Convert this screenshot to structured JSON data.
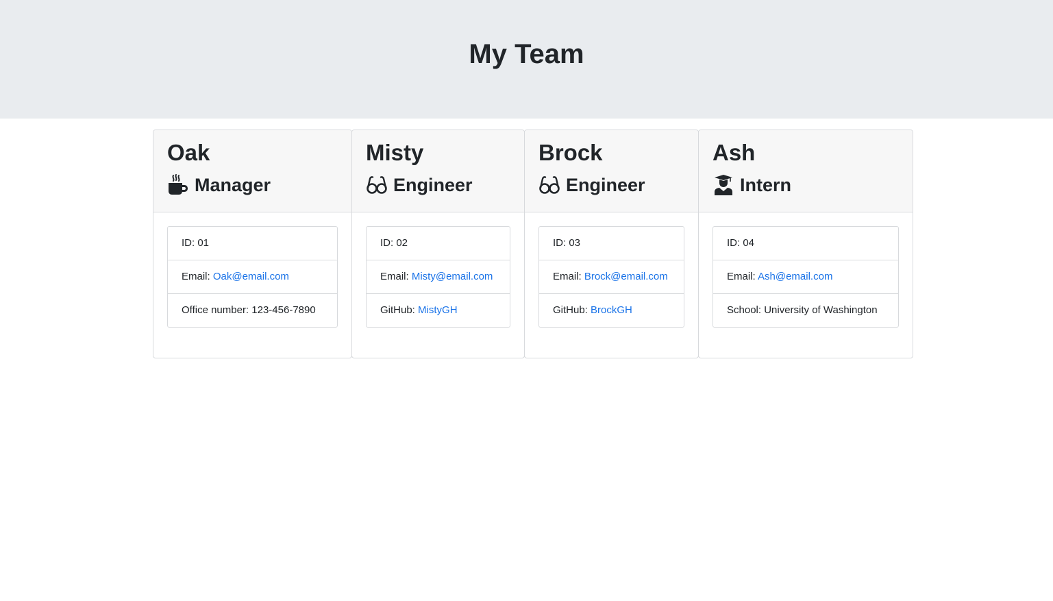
{
  "header": {
    "title": "My Team"
  },
  "members": [
    {
      "name": "Oak",
      "role": "Manager",
      "icon": "coffee-mug-icon",
      "id_label": "ID: 01",
      "email_prefix": "Email: ",
      "email": "Oak@email.com",
      "extra_prefix": "Office number: ",
      "extra_value": "123-456-7890"
    },
    {
      "name": "Misty",
      "role": "Engineer",
      "icon": "glasses-icon",
      "id_label": "ID: 02",
      "email_prefix": "Email: ",
      "email": "Misty@email.com",
      "extra_prefix": "GitHub: ",
      "extra_value": "MistyGH"
    },
    {
      "name": "Brock",
      "role": "Engineer",
      "icon": "glasses-icon",
      "id_label": "ID: 03",
      "email_prefix": "Email: ",
      "email": "Brock@email.com",
      "extra_prefix": "GitHub: ",
      "extra_value": "BrockGH"
    },
    {
      "name": "Ash",
      "role": "Intern",
      "icon": "graduate-icon",
      "id_label": "ID: 04",
      "email_prefix": "Email: ",
      "email": "Ash@email.com",
      "extra_prefix": "School: ",
      "extra_value": "University of Washington"
    }
  ],
  "colors": {
    "jumbotron": "#e9ecef",
    "link": "#1a73e8",
    "card_header": "#f7f7f7",
    "text": "#212529"
  }
}
